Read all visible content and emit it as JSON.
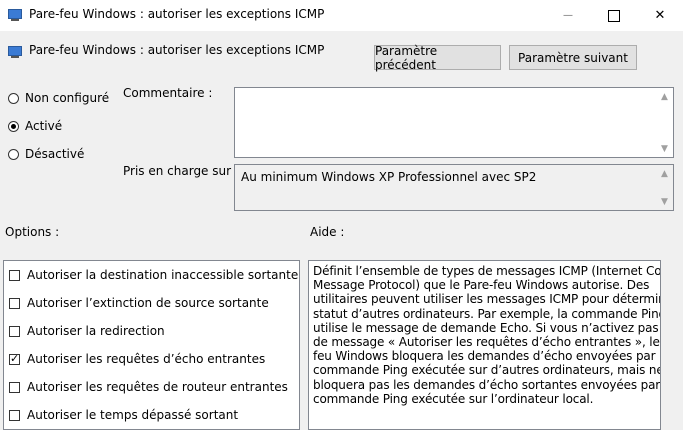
{
  "window": {
    "title": "Pare-feu Windows : autoriser les exceptions ICMP",
    "minimize_glyph": "—",
    "maximize_glyph": "☐",
    "close_glyph": "✕"
  },
  "header": {
    "policy_title": "Pare-feu Windows : autoriser les exceptions ICMP",
    "prev_button": "Paramètre précédent",
    "next_button": "Paramètre suivant"
  },
  "state": {
    "options": [
      {
        "label": "Non configuré",
        "selected": false
      },
      {
        "label": "Activé",
        "selected": true
      },
      {
        "label": "Désactivé",
        "selected": false
      }
    ]
  },
  "comment": {
    "label": "Commentaire :",
    "value": ""
  },
  "supported": {
    "label": "Pris en charge sur :",
    "value": "Au minimum Windows XP Professionnel avec SP2"
  },
  "options_section": {
    "label": "Options :",
    "items": [
      {
        "label": "Autoriser la destination inaccessible sortante",
        "checked": false
      },
      {
        "label": "Autoriser l’extinction de source sortante",
        "checked": false
      },
      {
        "label": "Autoriser la redirection",
        "checked": false
      },
      {
        "label": "Autoriser les requêtes d’écho entrantes",
        "checked": true
      },
      {
        "label": "Autoriser les requêtes de routeur entrantes",
        "checked": false
      },
      {
        "label": "Autoriser le temps dépassé sortant",
        "checked": false
      }
    ]
  },
  "help_section": {
    "label": "Aide :",
    "lines": [
      "Définit l’ensemble de types de messages ICMP (Internet Control",
      "Message Protocol) que le Pare-feu Windows autorise. Des",
      "utilitaires peuvent utiliser les messages ICMP pour déterminer le",
      "statut d’autres ordinateurs. Par exemple, la commande Ping",
      "utilise le message de demande Echo. Si vous n’activez pas le type",
      "de message « Autoriser les requêtes d’écho entrantes », le Pare-",
      "feu Windows bloquera les demandes d’écho envoyées par la",
      "commande Ping exécutée sur d’autres ordinateurs, mais ne",
      "bloquera pas les demandes d’écho sortantes envoyées par la",
      "commande Ping exécutée sur l’ordinateur local."
    ]
  },
  "icons": {
    "app_icon": "policy-window-icon",
    "scroll_up": "▲",
    "scroll_down": "▼"
  }
}
